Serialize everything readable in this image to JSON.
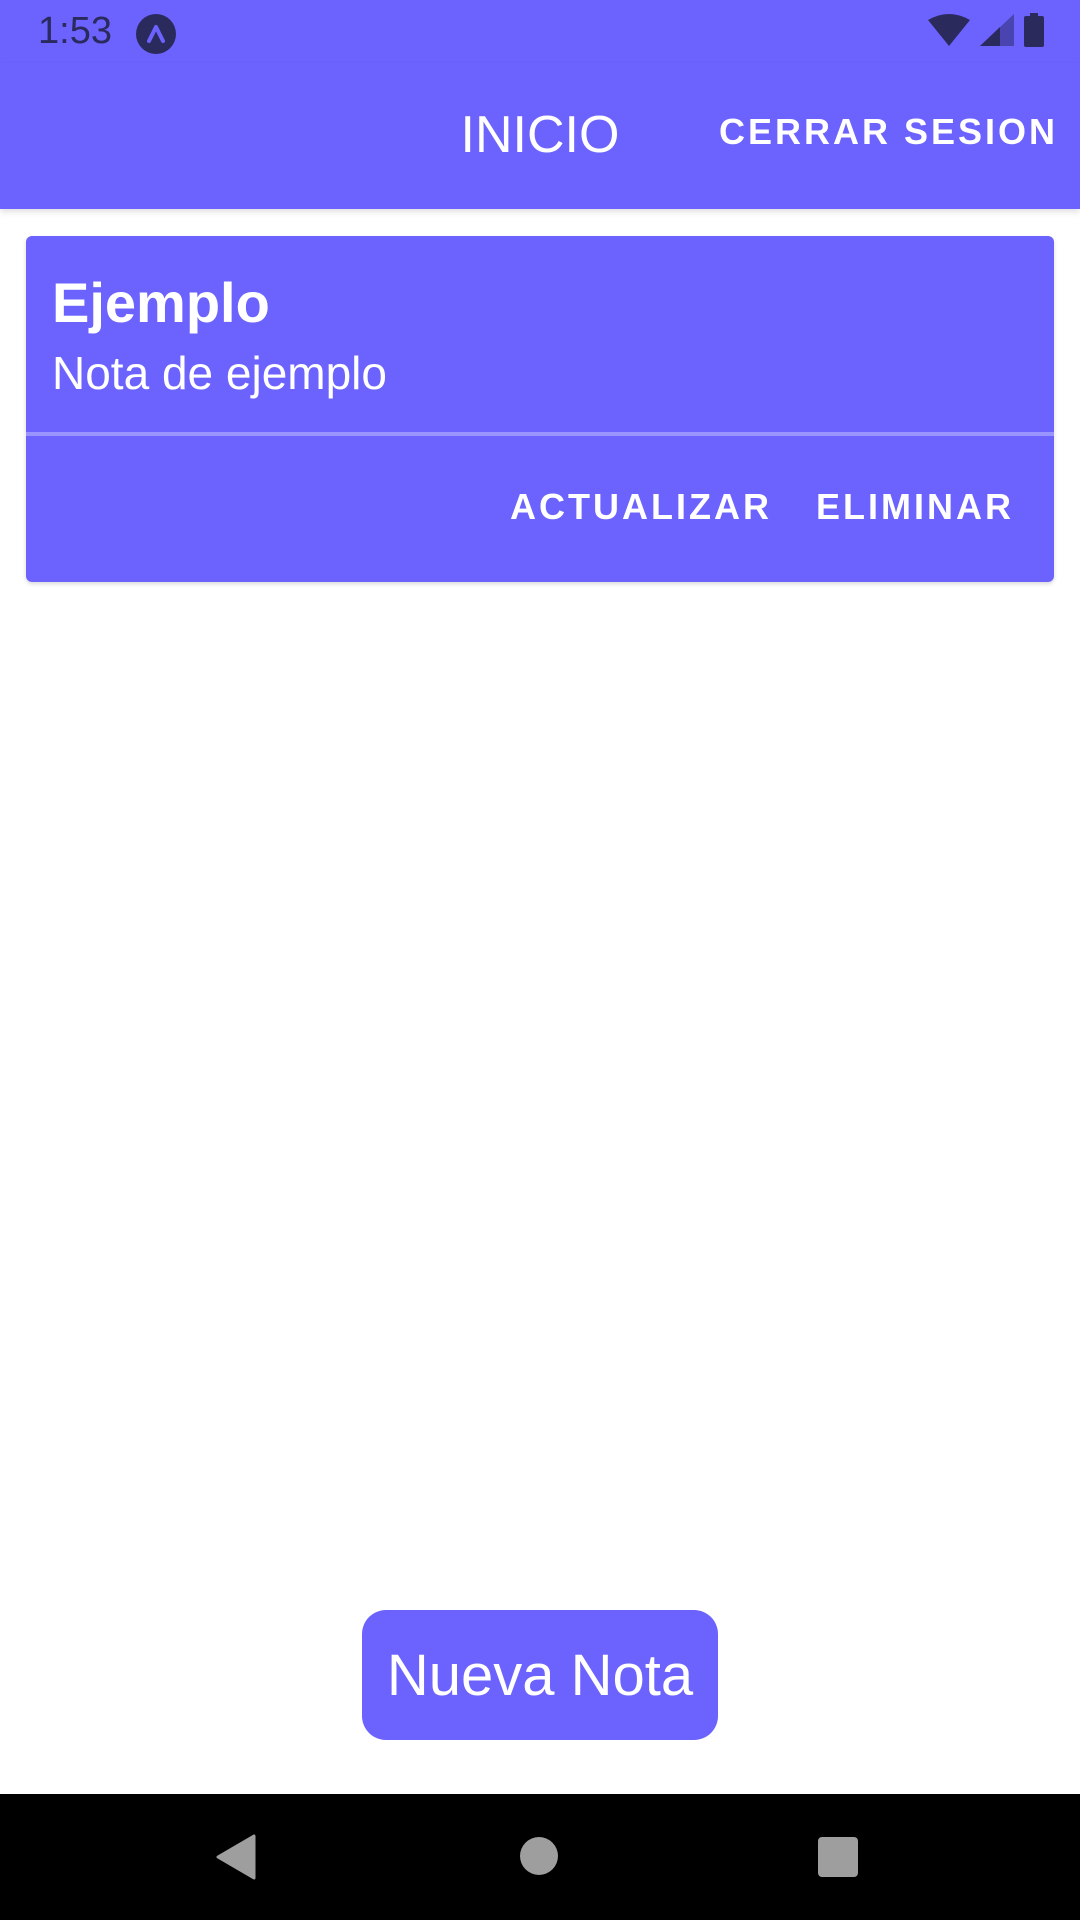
{
  "status_bar": {
    "time": "1:53",
    "icons": [
      "app-notification-icon",
      "wifi-icon",
      "cell-signal-icon",
      "battery-icon"
    ]
  },
  "app_bar": {
    "title": "INICIO",
    "logout_label": "CERRAR SESION"
  },
  "notes": [
    {
      "title": "Ejemplo",
      "body": "Nota de ejemplo",
      "actions": {
        "update_label": "ACTUALIZAR",
        "delete_label": "ELIMINAR"
      }
    }
  ],
  "new_note_label": "Nueva Nota",
  "nav_bar": {
    "icons": [
      "back-icon",
      "home-icon",
      "recents-icon"
    ]
  },
  "colors": {
    "accent": "#6c63ff",
    "on_accent": "#ffffff",
    "nav_background": "#000000"
  }
}
